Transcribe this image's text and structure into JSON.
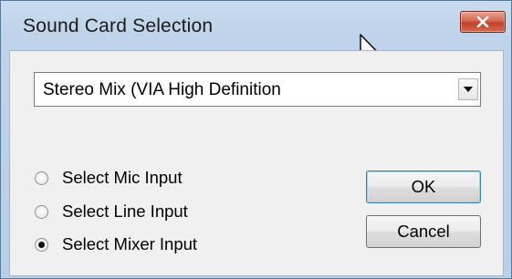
{
  "window": {
    "title": "Sound Card Selection",
    "close_icon": "close-x-icon"
  },
  "device_select": {
    "value": "Stereo Mix (VIA High Definition",
    "arrow_icon": "dropdown-arrow-icon"
  },
  "inputs": [
    {
      "label": "Select Mic Input",
      "checked": false
    },
    {
      "label": "Select Line Input",
      "checked": false
    },
    {
      "label": "Select Mixer Input",
      "checked": true
    }
  ],
  "buttons": {
    "ok": "OK",
    "cancel": "Cancel"
  },
  "colors": {
    "titlebar": "#bfd4ea",
    "close_button": "#c9472f",
    "client_bg": "#f0f0f0",
    "default_button_border": "#3c7fb1"
  }
}
